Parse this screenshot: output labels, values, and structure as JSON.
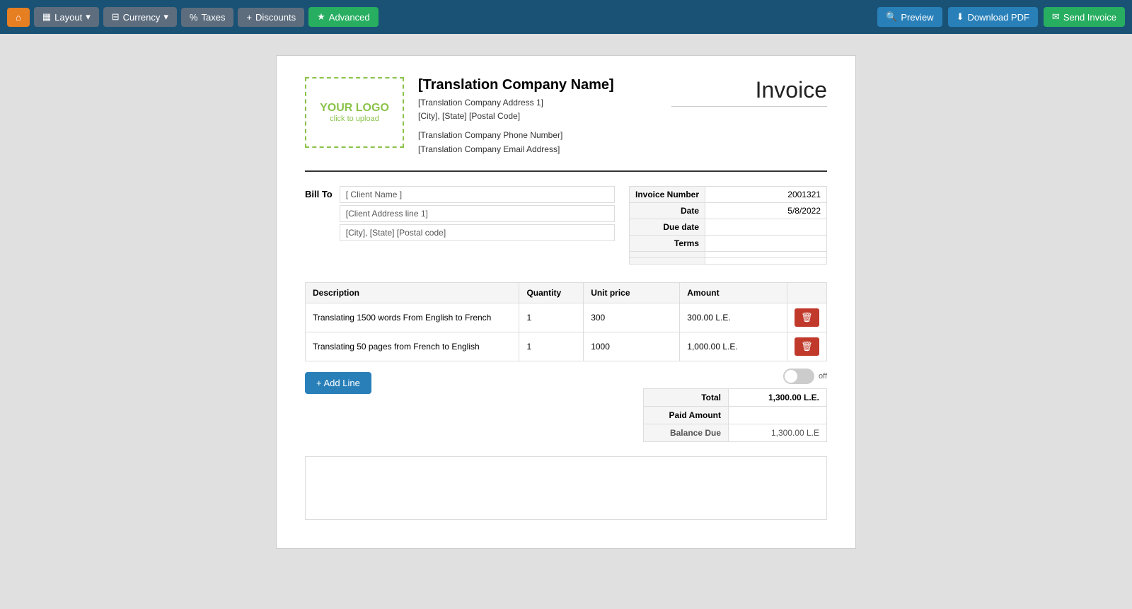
{
  "toolbar": {
    "home_label": "",
    "layout_label": "Layout",
    "currency_label": "Currency",
    "taxes_label": "Taxes",
    "discounts_label": "Discounts",
    "advanced_label": "Advanced",
    "preview_label": "Preview",
    "download_label": "Download PDF",
    "send_label": "Send Invoice"
  },
  "invoice": {
    "title": "Invoice",
    "logo_text": "YOUR LOGO",
    "logo_subtext": "click to upload",
    "company": {
      "name": "[Translation Company Name]",
      "address1": "[Translation Company Address 1]",
      "city_state": "[City], [State] [Postal Code]",
      "phone": "[Translation Company Phone Number]",
      "email": "[Translation Company Email Address]"
    },
    "bill_to_label": "Bill To",
    "bill_to": {
      "name": "[ Client Name ]",
      "address1": "[Client Address line 1]",
      "city_state": "[City], [State] [Postal code]"
    },
    "details": {
      "rows": [
        {
          "label": "Invoice Number",
          "value": "2001321"
        },
        {
          "label": "Date",
          "value": "5/8/2022"
        },
        {
          "label": "Due date",
          "value": ""
        },
        {
          "label": "Terms",
          "value": ""
        },
        {
          "label": "",
          "value": ""
        },
        {
          "label": "",
          "value": ""
        }
      ]
    },
    "table": {
      "headers": [
        "Description",
        "Quantity",
        "Unit price",
        "Amount",
        ""
      ],
      "rows": [
        {
          "description": "Translating 1500 words From English to French",
          "quantity": "1",
          "unit_price": "300",
          "amount": "300.00 L.E."
        },
        {
          "description": "Translating 50 pages from French to English",
          "quantity": "1",
          "unit_price": "1000",
          "amount": "1,000.00 L.E."
        }
      ]
    },
    "add_line_label": "+ Add Line",
    "toggle_label": "off",
    "totals": {
      "total_label": "Total",
      "total_value": "1,300.00 L.E.",
      "paid_label": "Paid Amount",
      "paid_value": "",
      "balance_label": "Balance Due",
      "balance_value": "1,300.00 L.E"
    }
  }
}
